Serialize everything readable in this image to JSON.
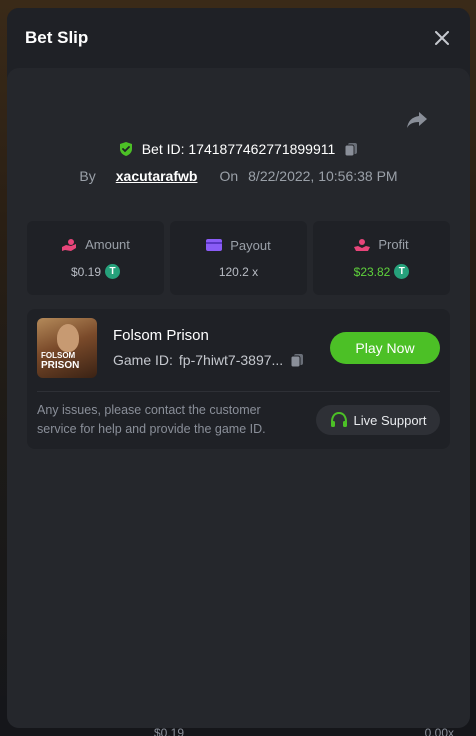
{
  "modal": {
    "title": "Bet Slip"
  },
  "bet": {
    "id_label": "Bet ID:",
    "id_value": "1741877462771899911",
    "by_label": "By",
    "user": "xacutarafwb",
    "on_label": "On",
    "date": "8/22/2022, 10:56:38 PM"
  },
  "stats": {
    "amount": {
      "label": "Amount",
      "value": "$0.19",
      "icon": "money-hand-icon"
    },
    "payout": {
      "label": "Payout",
      "value": "120.2 x",
      "icon": "card-icon"
    },
    "profit": {
      "label": "Profit",
      "value": "$23.82",
      "icon": "hand-coin-icon"
    }
  },
  "currency_icon": {
    "glyph": "T",
    "color": "#26a17b"
  },
  "game": {
    "title": "Folsom Prison",
    "id_label": "Game ID:",
    "id_value": "fp-7hiwt7-3897...",
    "thumb_line1": "FOLSOM",
    "thumb_line2": "PRISON",
    "play_label": "Play Now"
  },
  "help": {
    "text": "Any issues, please contact the customer service for help and provide the game ID.",
    "support_label": "Live Support"
  },
  "backdrop": {
    "amount": "$0.19",
    "mult": "0.00x"
  },
  "colors": {
    "accent_green": "#4cc026",
    "profit_green": "#5fd23c",
    "amount_pink": "#e8457a",
    "payout_purple": "#8a5cf6",
    "profit_red": "#e8457a"
  }
}
